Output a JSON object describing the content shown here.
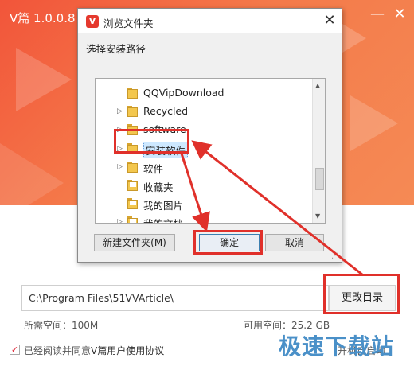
{
  "app": {
    "title": "V篇 1.0.0.8",
    "minimize_glyph": "—",
    "close_glyph": "✕"
  },
  "install": {
    "path_value": "C:\\Program Files\\51VVArticle\\",
    "change_dir_label": "更改目录",
    "space_required": "所需空间：100M",
    "space_available": "可用空间：25.2 GB",
    "agree_checked_glyph": "✓",
    "agree_prefix": "已经阅读并同意",
    "agree_link": "V篇用户使用协议",
    "auto_start": "开机自启动",
    "watermark": "极速下载站"
  },
  "dialog": {
    "logo_glyph": "V",
    "title": "浏览文件夹",
    "close_glyph": "✕",
    "prompt": "选择安装路径",
    "tree_items": [
      {
        "label": "QQVipDownload",
        "expandable": false
      },
      {
        "label": "Recycled",
        "expandable": true
      },
      {
        "label": "software",
        "expandable": true
      },
      {
        "label": "安装软件",
        "expandable": true
      },
      {
        "label": "软件",
        "expandable": true
      },
      {
        "label": "收藏夹",
        "expandable": false
      },
      {
        "label": "我的图片",
        "expandable": false
      },
      {
        "label": "我的文档",
        "expandable": true
      }
    ],
    "selected_item": "安装软件",
    "buttons": {
      "new_folder": "新建文件夹(M)",
      "ok": "确定",
      "cancel": "取消"
    },
    "expander_glyph": "▷",
    "scroll_up_glyph": "▲",
    "scroll_down_glyph": "▼"
  },
  "colors": {
    "banner_accent": "#f2553a",
    "annotation": "#e0302a",
    "watermark": "#4a90c8"
  }
}
